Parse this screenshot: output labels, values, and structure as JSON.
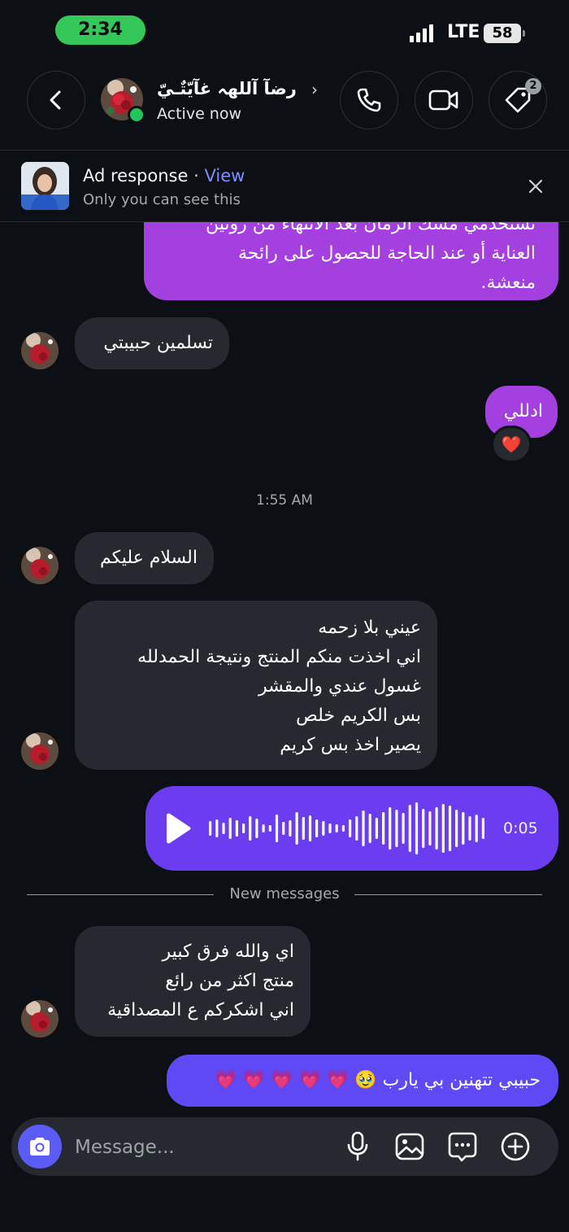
{
  "status_bar": {
    "time": "2:34",
    "network": "LTE",
    "battery": "58"
  },
  "header": {
    "name": "رضآ آللهہ غآيّتٌـيّ",
    "status": "Active now",
    "tag_badge": "2",
    "icons": [
      "back-icon",
      "phone-icon",
      "video-icon",
      "tag-icon"
    ]
  },
  "ad_banner": {
    "title": "Ad response",
    "separator": "·",
    "view_label": "View",
    "subtitle": "Only you can see this"
  },
  "messages": {
    "m0": {
      "lines": [
        "تستخدمي مسك الرمان بعد الانتهاء من روتين",
        "العناية أو عند الحاجة للحصول على رائحة",
        "منعشة."
      ]
    },
    "m1": "تسلمين حبيبتي",
    "m2": "ادللي",
    "m2_reaction": "❤️",
    "ts1": "1:55 AM",
    "m3": "السلام عليكم",
    "m4": {
      "lines": [
        "عيني بلا زحمه",
        "اني اخذت منكم المنتج ونتيجة الحمدلله",
        "غسول عندي والمقشر",
        "بس الكريم خلص",
        "يصير اخذ بس كريم"
      ]
    },
    "voice": {
      "duration": "0:05",
      "progress": 0
    },
    "new_messages": "New messages",
    "m5": {
      "lines": [
        "اي والله فرق كبير",
        "منتج اكثر من رائع",
        "اني اشكركم ع المصداقية"
      ]
    },
    "m6": "حبيبي تتهنين بي يارب 🥹 💗 💗 💗 💗 💗"
  },
  "composer": {
    "placeholder": "Message..."
  },
  "colors": {
    "accent": "#6c3df0",
    "outgoing_pink": "#a43fe0",
    "incoming": "#262a30",
    "online": "#22c55e"
  }
}
